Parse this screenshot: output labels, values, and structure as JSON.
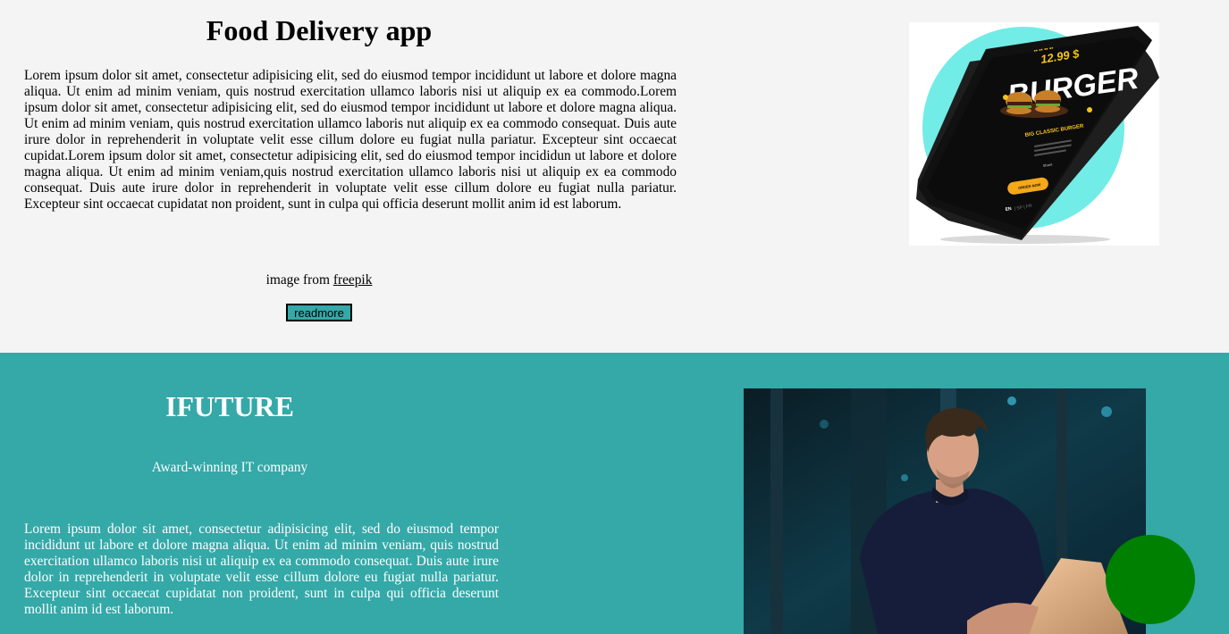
{
  "section1": {
    "title": "Food Delivery app",
    "body": "Lorem ipsum dolor sit amet, consectetur adipisicing elit, sed do eiusmod tempor incididunt ut labore et dolore magna aliqua. Ut enim ad minim veniam, quis nostrud exercitation ullamco laboris nisi ut aliquip ex ea commodo.Lorem ipsum dolor sit amet, consectetur adipisicing elit, sed do eiusmod tempor incididunt ut labore et dolore magna aliqua. Ut enim ad minim veniam, quis nostrud exercitation ullamco laboris nut aliquip ex ea commodo consequat. Duis aute irure dolor in reprehenderit in voluptate velit esse cillum dolore eu fugiat nulla pariatur. Excepteur sint occaecat cupidat.Lorem ipsum dolor sit amet, consectetur adipisicing elit, sed do eiusmod tempor incididun ut labore et dolore magna aliqua. Ut enim ad minim veniam,quis nostrud exercitation ullamco laboris nisi ut aliquip ex ea commodo consequat. Duis aute irure dolor in reprehenderit in voluptate velit esse cillum dolore eu fugiat nulla pariatur. Excepteur sint occaecat cupidatat non proident, sunt in culpa qui officia deserunt mollit anim id est laborum.",
    "credit_prefix": "image from ",
    "credit_link": "freepik",
    "readmore_label": "readmore",
    "phone": {
      "price": "12.99 $",
      "headline": "BURGER",
      "item_name": "BIG CLASSIC BURGER",
      "order_button": "ORDER NOW",
      "share": "Share",
      "lang": "EN",
      "lang_others": "| SP | FR"
    }
  },
  "section2": {
    "title": "IFUTURE",
    "tagline": "Award-winning IT company",
    "body": "Lorem ipsum dolor sit amet, consectetur adipisicing elit, sed do eiusmod tempor incididunt ut labore et dolore magna aliqua. Ut enim ad minim veniam, quis nostrud exercitation ullamco laboris nisi ut aliquip ex ea commodo consequat. Duis aute irure dolor in reprehenderit in voluptate velit esse cillum dolore eu fugiat nulla pariatur. Excepteur sint occaecat cupidatat non proident, sunt in culpa qui officia deserunt mollit anim id est laborum."
  },
  "colors": {
    "page_background": "#f4f4f4",
    "teal": "#35a8a8",
    "fab_green": "#008000",
    "phone_circle": "#72ece6"
  }
}
